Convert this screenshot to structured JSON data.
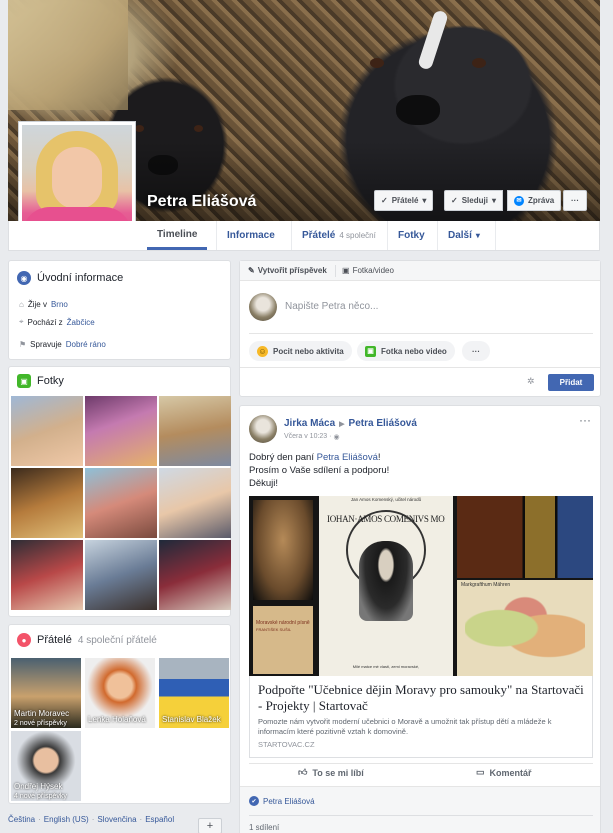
{
  "profile": {
    "name": "Petra Eliášová"
  },
  "cover_buttons": {
    "friends": "Přátelé",
    "follow": "Sleduji",
    "message": "Zpráva",
    "more": "···"
  },
  "tabs": [
    {
      "label": "Timeline"
    },
    {
      "label": "Informace"
    },
    {
      "label": "Přátelé",
      "count": "4 společní"
    },
    {
      "label": "Fotky"
    },
    {
      "label": "Další"
    }
  ],
  "intro": {
    "title": "Úvodní informace",
    "lives_prefix": "Žije v",
    "lives_link": "Brno",
    "from_prefix": "Pochází z",
    "from_link": "Žabčice",
    "manages_prefix": "Spravuje",
    "manages_link": "Dobré ráno"
  },
  "photos": {
    "title": "Fotky"
  },
  "friends": {
    "title": "Přátelé",
    "subtitle": "4 společní přátelé",
    "items": [
      {
        "name": "Martin Moravec",
        "posts": "2 nové příspěvky"
      },
      {
        "name": "Lenka Holaňová",
        "posts": ""
      },
      {
        "name": "Stanislav Blažek",
        "posts": ""
      },
      {
        "name": "Ondřej Hýsek",
        "posts": "4 nové příspěvky"
      }
    ]
  },
  "footer": {
    "links": [
      "Čeština",
      "English (US)",
      "Slovenčina",
      "Español"
    ],
    "add": "+"
  },
  "composer": {
    "tab_create": "Vytvořit příspěvek",
    "tab_photo": "Fotka/video",
    "placeholder": "Napište Petra něco...",
    "feeling": "Pocit nebo aktivita",
    "photo": "Fotka nebo video",
    "more": "···",
    "submit": "Přidat"
  },
  "post": {
    "author": "Jirka Máca",
    "target": "Petra Eliášová",
    "time": "Včera v 10:23 ·",
    "more": "···",
    "lines": [
      "Dobrý den paní ",
      "Prosím o Vaše sdílení a podporu!",
      "Děkuji!"
    ],
    "mention": "Petra Eliášová",
    "mention_end": "!",
    "image_caption": "Jan Amos Komenský, učitel národů",
    "portrait_text": "IOHAN·AMOS COMENIVS MORAVVS·A·ÆTAT",
    "book_text": "Moravské národní písně",
    "book_author": "FRANTIŠEK SUŠIL",
    "quote": "Milé matce mé vlasti, zemi moravské,",
    "map_title": "Markgrafthum Mähren",
    "link_title": "Podpořte \"Učebnice dějin Moravy pro samouky\" na Startovači - Projekty | Startovač",
    "link_desc": "Pomozte nám vytvořit moderní učebnici o Moravě a umožnit tak přístup dětí a mládeže k informacím které pozitivně vztah k domovině.",
    "link_domain": "STARTOVAC.CZ",
    "like": "To se mi líbí",
    "comment": "Komentář",
    "reaction_name": "Petra Eliášová",
    "shares": "1 sdílení"
  },
  "colors": {
    "link": "#365899",
    "accent": "#4267b2",
    "bg": "#e9ebee"
  }
}
